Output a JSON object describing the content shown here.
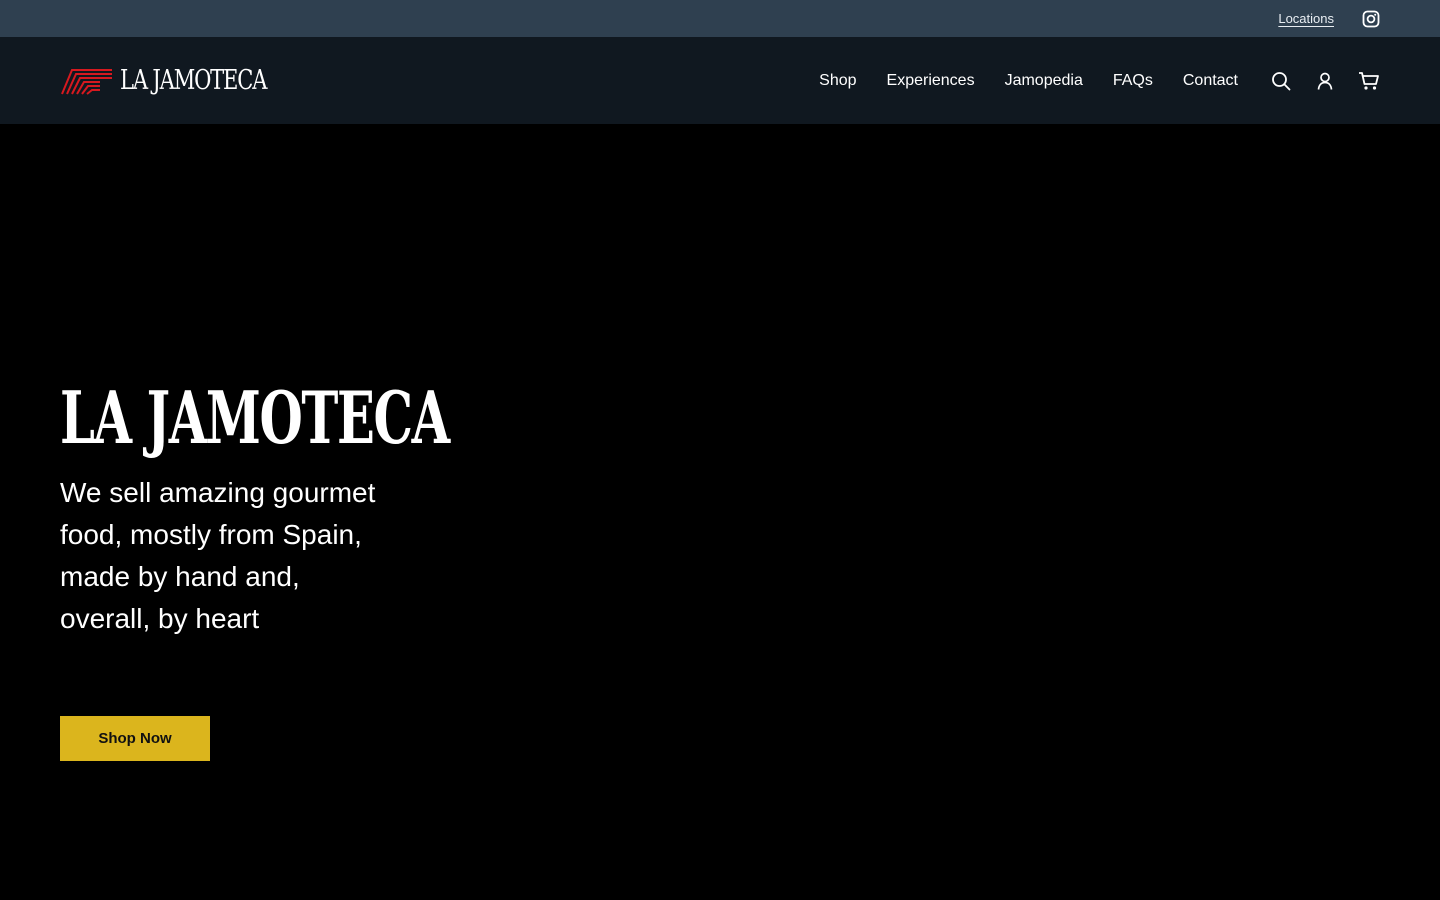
{
  "topbar": {
    "locations_label": "Locations",
    "instagram_icon": "instagram-icon"
  },
  "header": {
    "brand_name": "LA JAMOTECA",
    "logo_icon": "jamoteca-logo-mark",
    "nav": [
      {
        "label": "Shop"
      },
      {
        "label": "Experiences"
      },
      {
        "label": "Jamopedia"
      },
      {
        "label": "FAQs"
      },
      {
        "label": "Contact"
      }
    ],
    "icons": [
      "search-icon",
      "account-icon",
      "cart-icon"
    ]
  },
  "hero": {
    "title": "LA JAMOTECA",
    "tagline": "We sell amazing gourmet food, mostly from Spain, made by hand and, overall, by heart",
    "cta_label": "Shop Now"
  },
  "colors": {
    "topbar_bg": "#2f4050",
    "header_bg": "#101820",
    "hero_bg": "#000000",
    "logo_red": "#d7191f",
    "cta_yellow": "#dbb51d"
  }
}
